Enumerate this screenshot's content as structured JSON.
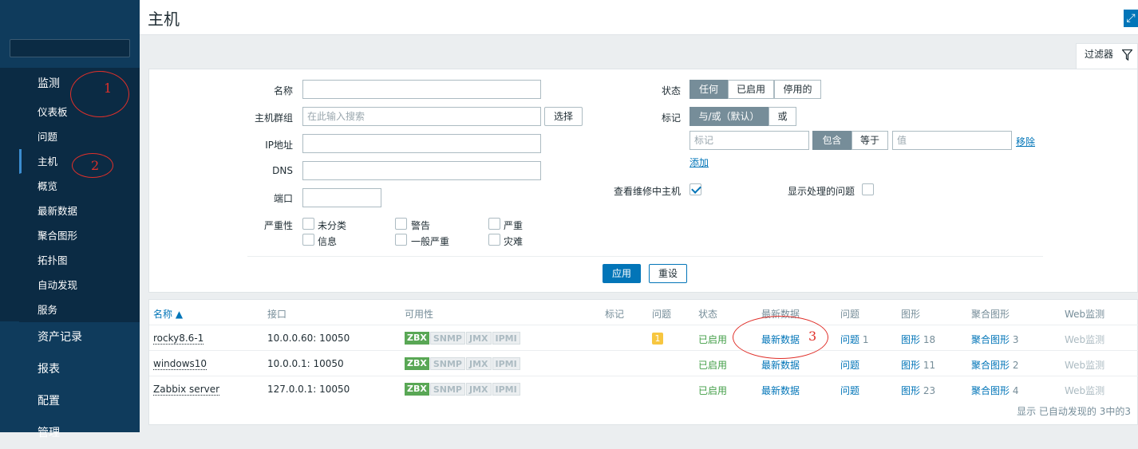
{
  "sidebar": {
    "sections": [
      {
        "label": "监测"
      },
      {
        "label": "资产记录"
      },
      {
        "label": "报表"
      },
      {
        "label": "配置"
      },
      {
        "label": "管理"
      }
    ],
    "monitoring_items": [
      {
        "label": "仪表板"
      },
      {
        "label": "问题"
      },
      {
        "label": "主机"
      },
      {
        "label": "概览"
      },
      {
        "label": "最新数据"
      },
      {
        "label": "聚合图形"
      },
      {
        "label": "拓扑图"
      },
      {
        "label": "自动发现"
      },
      {
        "label": "服务"
      }
    ]
  },
  "header": {
    "title": "主机"
  },
  "filter": {
    "tab_label": "过滤器",
    "name_label": "名称",
    "name_value": "",
    "hostgroup_label": "主机群组",
    "hostgroup_placeholder": "在此输入搜索",
    "select_button": "选择",
    "ip_label": "IP地址",
    "dns_label": "DNS",
    "port_label": "端口",
    "severity_label": "严重性",
    "severities": [
      "未分类",
      "警告",
      "严重",
      "信息",
      "一般严重",
      "灾难"
    ],
    "status_label": "状态",
    "status_options": [
      "任何",
      "已启用",
      "停用的"
    ],
    "tags_label": "标记",
    "tag_ops": [
      "与/或（默认）",
      "或"
    ],
    "tag_placeholder": "标记",
    "tag_match": [
      "包含",
      "等于"
    ],
    "value_placeholder": "值",
    "remove_link": "移除",
    "add_link": "添加",
    "maintenance_label": "查看维修中主机",
    "show_suppressed_label": "显示处理的问题",
    "apply_button": "应用",
    "reset_button": "重设"
  },
  "table": {
    "columns": [
      "名称 ▲",
      "接口",
      "可用性",
      "标记",
      "问题",
      "状态",
      "最新数据",
      "问题",
      "图形",
      "聚合图形",
      "Web监测"
    ],
    "availability_tags": [
      "ZBX",
      "SNMP",
      "JMX",
      "IPMI"
    ],
    "rows": [
      {
        "name": "rocky8.6-1",
        "interface": "10.0.0.60: 10050",
        "problem_badge": "1",
        "status": "已启用",
        "latest": "最新数据",
        "problems": "问题",
        "problems_count": "1",
        "graphs": "图形",
        "graphs_count": "18",
        "screens": "聚合图形",
        "screens_count": "3",
        "web": "Web监测"
      },
      {
        "name": "windows10",
        "interface": "10.0.0.1: 10050",
        "problem_badge": "",
        "status": "已启用",
        "latest": "最新数据",
        "problems": "问题",
        "problems_count": "",
        "graphs": "图形",
        "graphs_count": "11",
        "screens": "聚合图形",
        "screens_count": "2",
        "web": "Web监测"
      },
      {
        "name": "Zabbix server",
        "interface": "127.0.0.1: 10050",
        "problem_badge": "",
        "status": "已启用",
        "latest": "最新数据",
        "problems": "问题",
        "problems_count": "",
        "graphs": "图形",
        "graphs_count": "23",
        "screens": "聚合图形",
        "screens_count": "4",
        "web": "Web监测"
      }
    ],
    "footer": "显示 已自动发现的 3中的3"
  },
  "annotations": [
    "1",
    "2",
    "3"
  ]
}
